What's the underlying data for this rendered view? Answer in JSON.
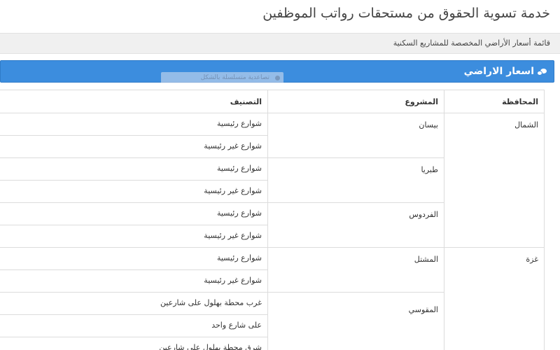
{
  "header": {
    "title": "خدمة تسوية الحقوق من مستحقات رواتب الموظفين"
  },
  "breadcrumb": {
    "text": "قائمة أسعار الأراضي المخصصة للمشاريع السكنية"
  },
  "panel": {
    "title": "اسعار الاراضي",
    "icon": "comments-icon"
  },
  "overlay": {
    "text": "تصاعدية متسلسلة بالشكل"
  },
  "table": {
    "headers": {
      "governorate": "المحافظة",
      "project": "المشروع",
      "classification": "التصنيف"
    },
    "groups": [
      {
        "governorate": "الشمال",
        "projects": [
          {
            "name": "بيسان",
            "rows": [
              "شوارع رئيسية",
              "شوارع غير رئيسية"
            ]
          },
          {
            "name": "طبريا",
            "rows": [
              "شوارع رئيسية",
              "شوارع غير رئيسية"
            ]
          },
          {
            "name": "الفردوس",
            "rows": [
              "شوارع رئيسية",
              "شوارع غير رئيسية"
            ]
          }
        ]
      },
      {
        "governorate": "غزة",
        "projects": [
          {
            "name": "المشتل",
            "rows": [
              "شوارع رئيسية",
              "شوارع غير رئيسية"
            ]
          },
          {
            "name": "المقوسي",
            "rows": [
              "غرب محطة بهلول على شارعين",
              "على شارع واحد",
              "شرق محطة بهلول على شارعين"
            ]
          }
        ]
      }
    ]
  },
  "colors": {
    "panel": "#3c8dde",
    "border": "#dcdcdc",
    "breadcrumb_bg": "#f0f0f0"
  }
}
